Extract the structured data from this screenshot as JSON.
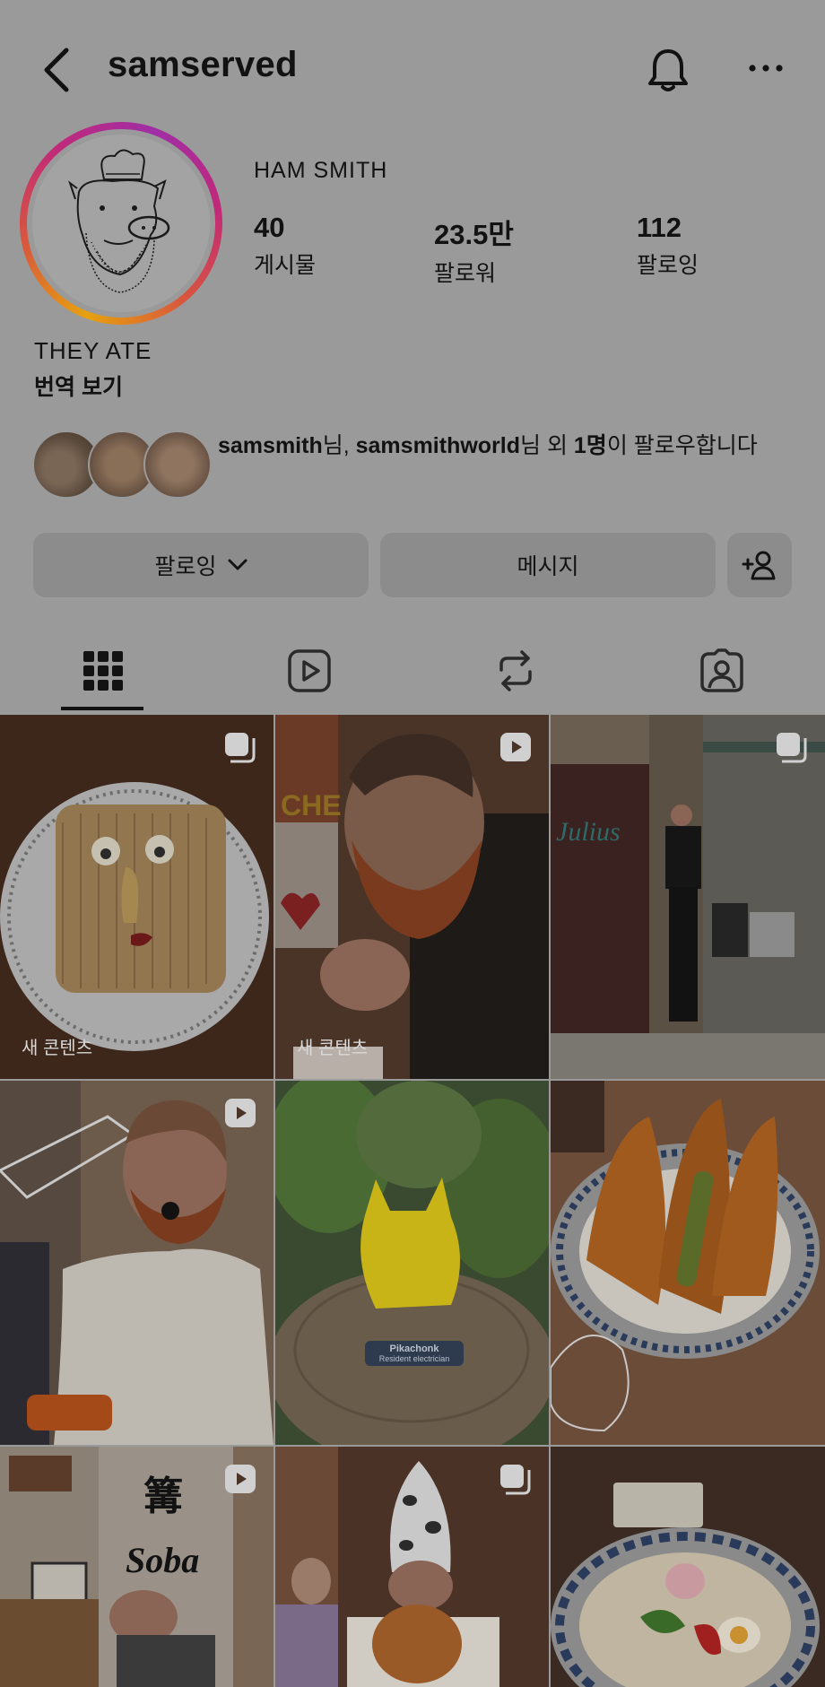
{
  "header": {
    "username": "samserved"
  },
  "profile": {
    "display_name": "HAM SMITH",
    "stats": [
      {
        "value": "40",
        "label": "게시물"
      },
      {
        "value": "23.5만",
        "label": "팔로워"
      },
      {
        "value": "112",
        "label": "팔로잉"
      }
    ],
    "bio": "THEY ATE",
    "translate": "번역 보기"
  },
  "followed_by": {
    "user1": "samsmith",
    "sep1": "님, ",
    "user2": "samsmithworld",
    "sep2": "님 외 ",
    "count": "1명",
    "tail": "이 팔로우합니다"
  },
  "actions": {
    "following": "팔로잉",
    "message": "메시지"
  },
  "tabs": [
    "grid",
    "reels",
    "reposts",
    "tagged"
  ],
  "posts": [
    {
      "caption": "새 콘텐츠",
      "type": "carousel",
      "alt": "cake with face"
    },
    {
      "caption": "새 콘텐츠",
      "type": "reel",
      "alt": "man eating"
    },
    {
      "caption": "",
      "type": "carousel",
      "alt": "man at Julius door"
    },
    {
      "caption": "",
      "type": "reel",
      "alt": "man with microphone"
    },
    {
      "caption": "",
      "type": "none",
      "alt": "yellow statue"
    },
    {
      "caption": "",
      "type": "none",
      "alt": "tempura bowl"
    },
    {
      "caption": "",
      "type": "reel",
      "alt": "soba shop"
    },
    {
      "caption": "",
      "type": "carousel",
      "alt": "man with hat"
    },
    {
      "caption": "",
      "type": "none",
      "alt": "ramen bowl"
    }
  ],
  "photo_texts": {
    "julius": "Julius",
    "soba": "Soba",
    "statue_sign": "Pikachonk",
    "statue_sub": "Resident electrician",
    "che": "CHE"
  },
  "colors": {
    "overlay_bg": "#9a9a9a",
    "button_bg": "#8c8c8c",
    "ring_start": "#e6a10f",
    "ring_end": "#a02ea6"
  }
}
